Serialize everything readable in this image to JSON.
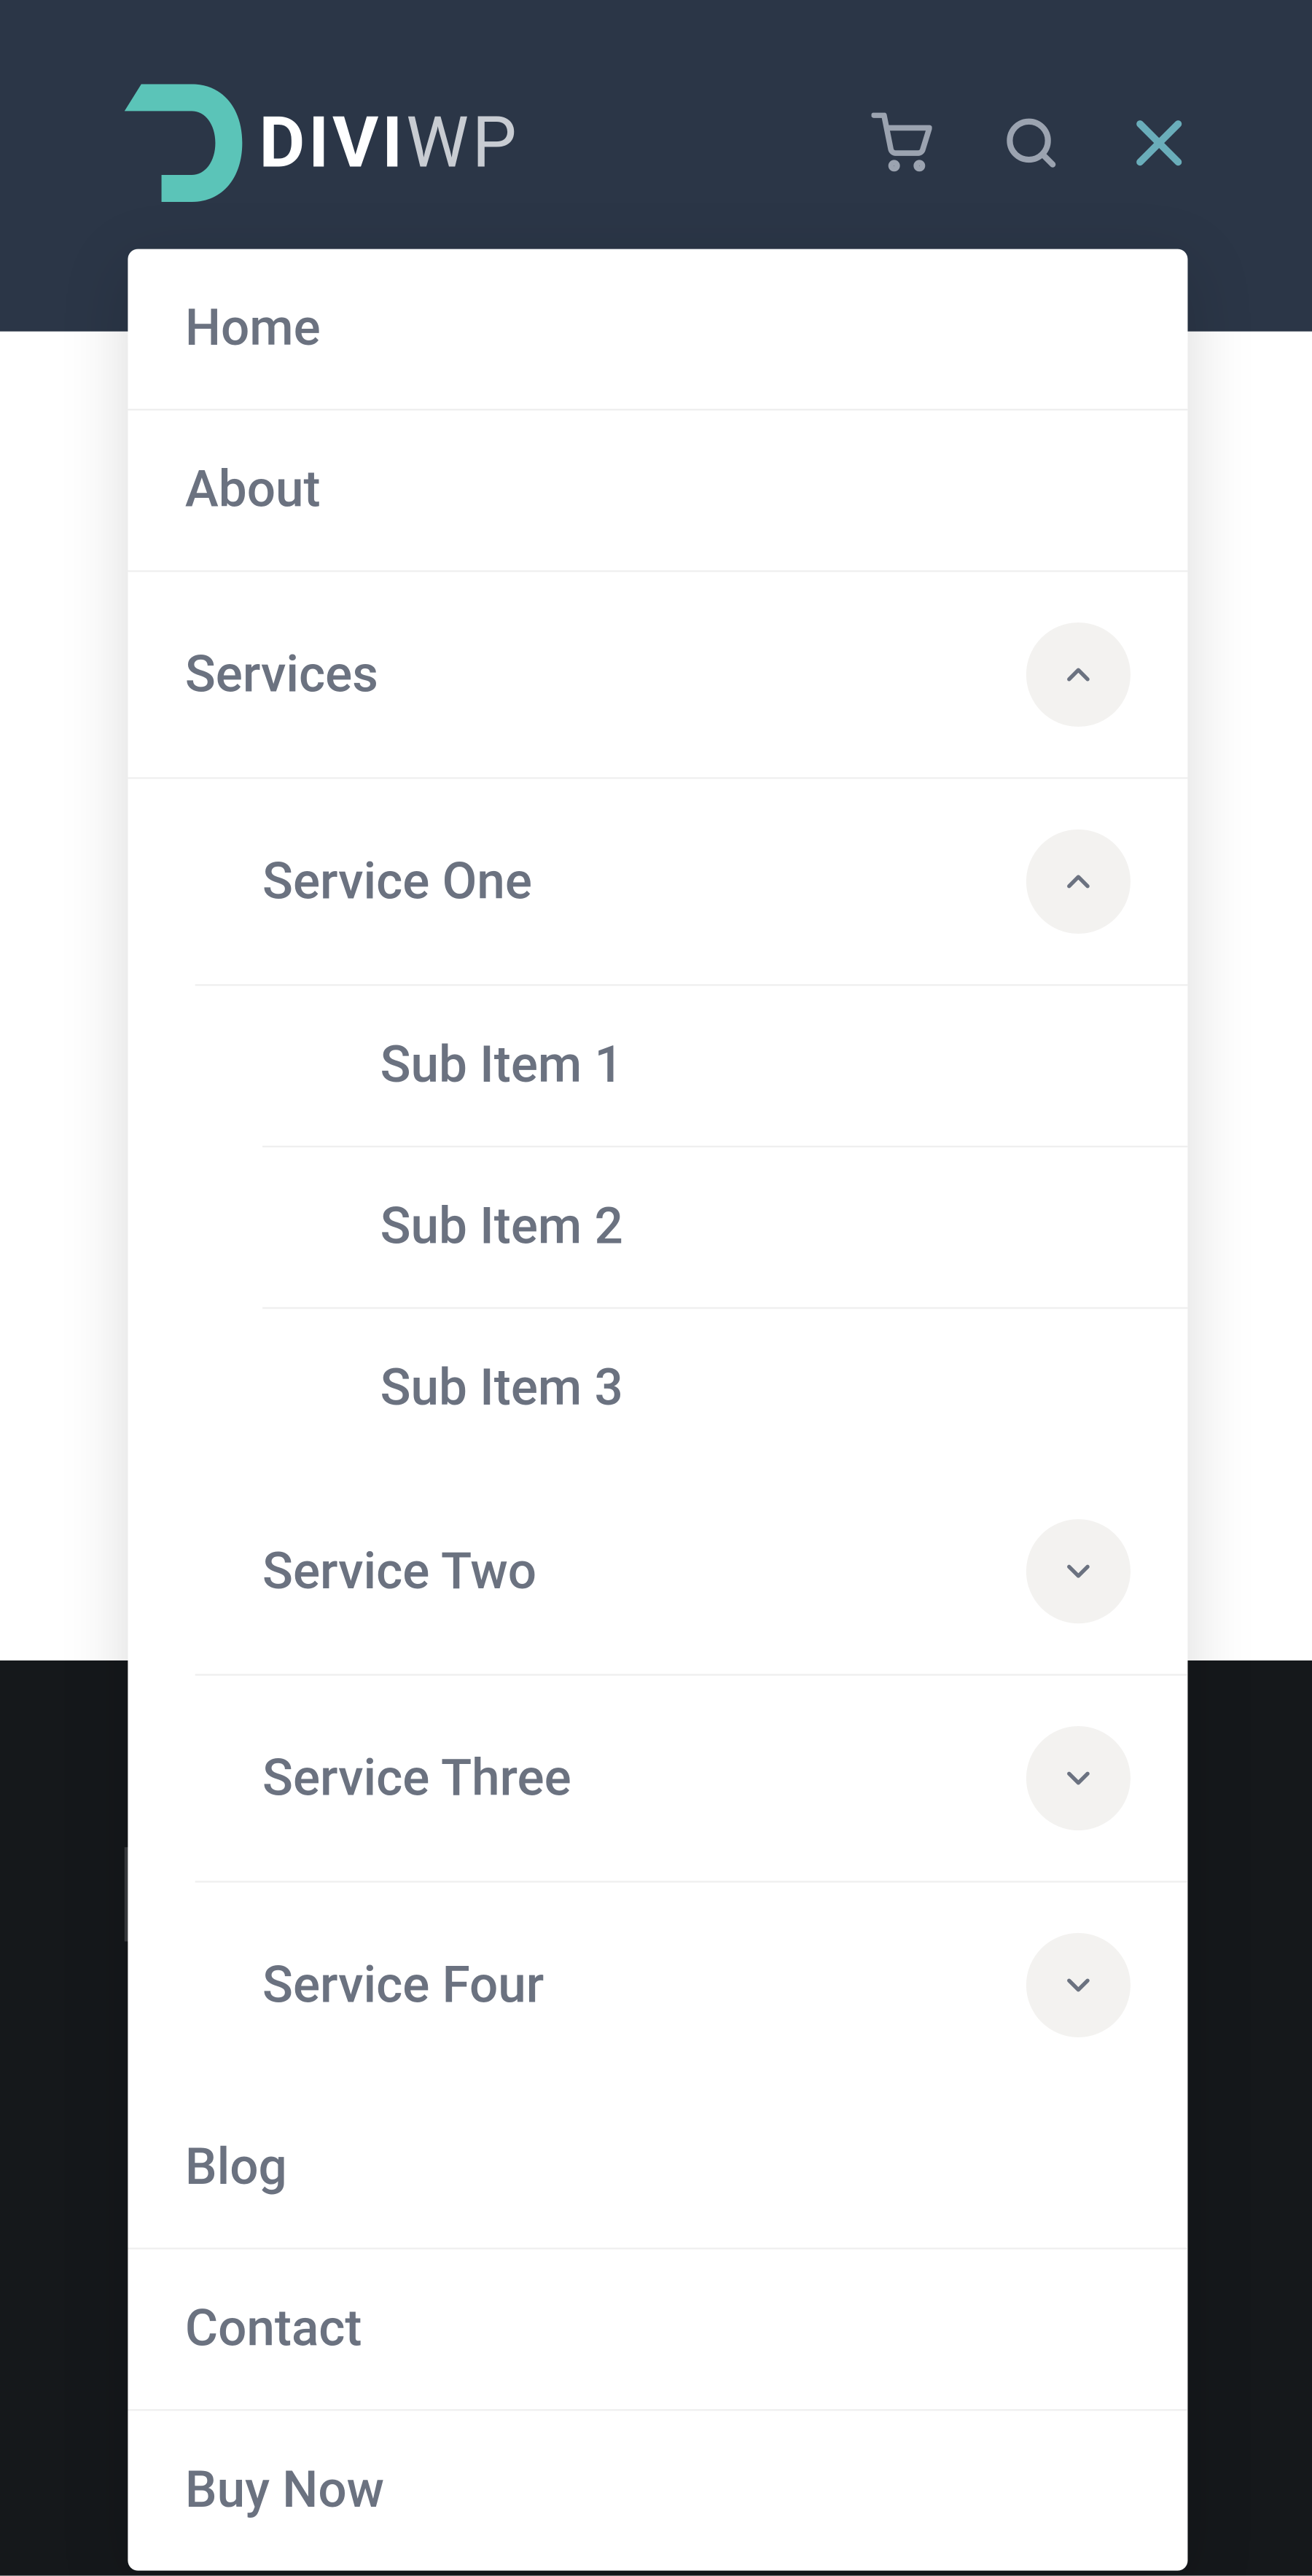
{
  "logo": {
    "text_divi": "DIVI",
    "text_wp": "WP"
  },
  "menu": {
    "items": [
      {
        "label": "Home"
      },
      {
        "label": "About"
      },
      {
        "label": "Services"
      },
      {
        "label": "Service One"
      },
      {
        "label": "Sub Item 1"
      },
      {
        "label": "Sub Item 2"
      },
      {
        "label": "Sub Item 3"
      },
      {
        "label": "Service Two"
      },
      {
        "label": "Service Three"
      },
      {
        "label": "Service Four"
      },
      {
        "label": "Blog"
      },
      {
        "label": "Contact"
      },
      {
        "label": "Buy Now"
      }
    ]
  }
}
